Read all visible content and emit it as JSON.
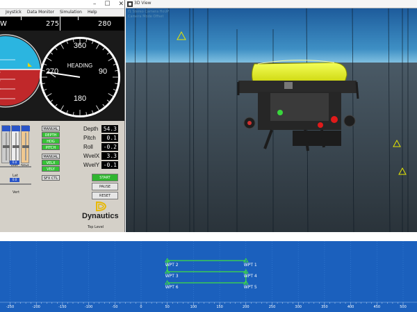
{
  "control_window": {
    "menu": [
      "Joystick",
      "Data Monitor",
      "Simulation",
      "Help"
    ],
    "compass": {
      "marks": [
        "W",
        "275",
        "280"
      ]
    },
    "heading_gauge": {
      "label": "HEADING",
      "n": "360",
      "e": "90",
      "s": "180",
      "w": "270"
    },
    "sliders": [
      {
        "label": "Port",
        "value": "0.0"
      },
      {
        "label": "Stbd",
        "value": "0.0"
      }
    ],
    "hsliders": [
      {
        "label": "Lat",
        "value": "0.0"
      },
      {
        "label": "Vert",
        "value": "0.0"
      }
    ],
    "mode_buttons": [
      {
        "label": "MANUAL",
        "style": "gray"
      },
      {
        "label": "DEPTH",
        "style": "green"
      },
      {
        "label": "HDG",
        "style": "green"
      },
      {
        "label": "PITCH",
        "style": "green"
      },
      {
        "label": "MANUAL",
        "style": "gray"
      },
      {
        "label": "VELX",
        "style": "green"
      },
      {
        "label": "VELY",
        "style": "green"
      },
      {
        "label": "SFX CTL",
        "style": "gray"
      }
    ],
    "readouts": [
      {
        "label": "Depth",
        "value": "54.3"
      },
      {
        "label": "Pitch",
        "value": "0.1"
      },
      {
        "label": "Roll",
        "value": "-0.2"
      },
      {
        "label": "WvelX",
        "value": "3.3"
      },
      {
        "label": "WvelY",
        "value": "-0.1"
      }
    ],
    "sim_buttons": [
      {
        "label": "START",
        "style": "green"
      },
      {
        "label": "PAUSE",
        "style": "gray"
      },
      {
        "label": "RESET",
        "style": "gray"
      }
    ],
    "brand": "Dynautics",
    "status": "Top Level"
  },
  "view_window": {
    "title": "3D View",
    "menu_line1": "f1  Stereo  Camera  HoUP",
    "menu_line2": "Camera  Mode  Offset"
  },
  "plot": {
    "x_ticks": [
      "-250",
      "-200",
      "-150",
      "-100",
      "-50",
      "0",
      "50",
      "100",
      "150",
      "200",
      "250",
      "300",
      "350",
      "400",
      "450",
      "500"
    ],
    "waypoints": [
      {
        "name": "WPT 1",
        "x": 200,
        "y": 0
      },
      {
        "name": "WPT 2",
        "x": 50,
        "y": 0
      },
      {
        "name": "WPT 3",
        "x": 50,
        "y": -20
      },
      {
        "name": "WPT 4",
        "x": 200,
        "y": -20
      },
      {
        "name": "WPT 5",
        "x": 200,
        "y": -40
      },
      {
        "name": "WPT 6",
        "x": 50,
        "y": -40
      }
    ],
    "colors": {
      "background": "#1b60bd",
      "path": "#3fe03f"
    }
  }
}
